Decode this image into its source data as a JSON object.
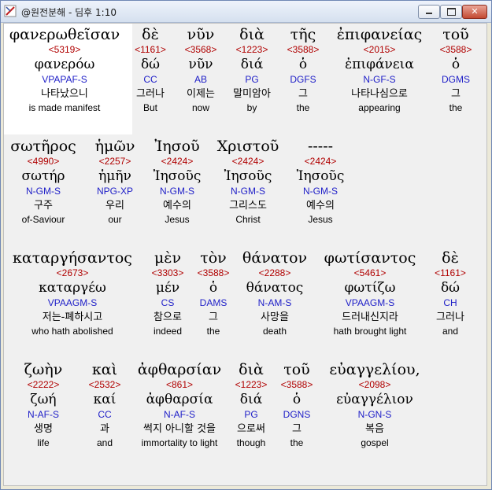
{
  "window": {
    "title": "@원전분해 - 딤후 1:10",
    "buttons": {
      "minimize": "minimize",
      "maximize": "maximize",
      "close": "✕"
    }
  },
  "rows": [
    {
      "words": [
        {
          "greek": "φανερωθεῖσαν",
          "strong": "<5319>",
          "lemma": "φανερόω",
          "morph": "VPAPAF-S",
          "korean": "나타났으니",
          "english": "is made manifest"
        },
        {
          "greek": "δὲ",
          "strong": "<1161>",
          "lemma": "δώ",
          "morph": "CC",
          "korean": "그러나",
          "english": "But"
        },
        {
          "greek": "νῦν",
          "strong": "<3568>",
          "lemma": "νῦν",
          "morph": "AB",
          "korean": "이제는",
          "english": "now"
        },
        {
          "greek": "διὰ",
          "strong": "<1223>",
          "lemma": "διά",
          "morph": "PG",
          "korean": "말미암아",
          "english": "by"
        },
        {
          "greek": "τῆς",
          "strong": "<3588>",
          "lemma": "ὁ",
          "morph": "DGFS",
          "korean": "그",
          "english": "the"
        },
        {
          "greek": "ἐπιφανείας",
          "strong": "<2015>",
          "lemma": "ἐπιφάνεια",
          "morph": "N-GF-S",
          "korean": "나타나심으로",
          "english": "appearing"
        },
        {
          "greek": "τοῦ",
          "strong": "<3588>",
          "lemma": "ὁ",
          "morph": "DGMS",
          "korean": "그",
          "english": "the"
        }
      ]
    },
    {
      "words": [
        {
          "greek": "σωτῆρος",
          "strong": "<4990>",
          "lemma": "σωτήρ",
          "morph": "N-GM-S",
          "korean": "구주",
          "english": "of-Saviour"
        },
        {
          "greek": "ἡμῶν",
          "strong": "<2257>",
          "lemma": "ἡμῆν",
          "morph": "NPG-XP",
          "korean": "우리",
          "english": "our"
        },
        {
          "greek": "Ἰησοῦ",
          "strong": "<2424>",
          "lemma": "Ἰησοῦς",
          "morph": "N-GM-S",
          "korean": "예수의",
          "english": "Jesus"
        },
        {
          "greek": "Χριστοῦ",
          "strong": "<2424>",
          "lemma": "Ἰησοῦς",
          "morph": "N-GM-S",
          "korean": "그리스도",
          "english": "Christ"
        },
        {
          "greek": "-----",
          "strong": "<2424>",
          "lemma": "Ἰησοῦς",
          "morph": "N-GM-S",
          "korean": "예수의",
          "english": "Jesus"
        }
      ]
    },
    {
      "words": [
        {
          "greek": "καταργήσαντος",
          "strong": "<2673>",
          "lemma": "καταργέω",
          "morph": "VPAAGM-S",
          "korean": "저는-폐하시고",
          "english": "who hath abolished"
        },
        {
          "greek": "μὲν",
          "strong": "<3303>",
          "lemma": "μέν",
          "morph": "CS",
          "korean": "참으로",
          "english": "indeed"
        },
        {
          "greek": "τὸν",
          "strong": "<3588>",
          "lemma": "ὁ",
          "morph": "DAMS",
          "korean": "그",
          "english": "the"
        },
        {
          "greek": "θάνατον",
          "strong": "<2288>",
          "lemma": "θάνατος",
          "morph": "N-AM-S",
          "korean": "사망을",
          "english": "death"
        },
        {
          "greek": "φωτίσαντος",
          "strong": "<5461>",
          "lemma": "φωτίζω",
          "morph": "VPAAGM-S",
          "korean": "드러내신지라",
          "english": "hath brought light"
        },
        {
          "greek": "δὲ",
          "strong": "<1161>",
          "lemma": "δώ",
          "morph": "CH",
          "korean": "그러나",
          "english": "and"
        }
      ]
    },
    {
      "words": [
        {
          "greek": "ζωὴν",
          "strong": "<2222>",
          "lemma": "ζωή",
          "morph": "N-AF-S",
          "korean": "생명",
          "english": "life"
        },
        {
          "greek": "καὶ",
          "strong": "<2532>",
          "lemma": "καί",
          "morph": "CC",
          "korean": "과",
          "english": "and"
        },
        {
          "greek": "ἀφθαρσίαν",
          "strong": "<861>",
          "lemma": "ἀφθαρσία",
          "morph": "N-AF-S",
          "korean": "썩지 아니할 것을",
          "english": "immortality to light"
        },
        {
          "greek": "διὰ",
          "strong": "<1223>",
          "lemma": "διά",
          "morph": "PG",
          "korean": "으로써",
          "english": "though"
        },
        {
          "greek": "τοῦ",
          "strong": "<3588>",
          "lemma": "ὁ",
          "morph": "DGNS",
          "korean": "그",
          "english": "the"
        },
        {
          "greek": "εὐαγγελίου,",
          "strong": "<2098>",
          "lemma": "εὐαγγέλιον",
          "morph": "N-GN-S",
          "korean": "복음",
          "english": "gospel"
        }
      ]
    }
  ]
}
